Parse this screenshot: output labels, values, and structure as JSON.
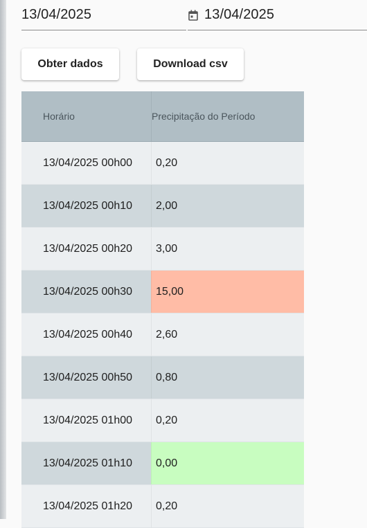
{
  "filters": {
    "start_date": "13/04/2025",
    "end_date": "13/04/2025",
    "calendar_icon": "calendar-icon"
  },
  "actions": {
    "fetch_label": "Obter dados",
    "download_label": "Download csv"
  },
  "table": {
    "headers": {
      "time": "Horário",
      "precipitation": "Precipitação do Período"
    },
    "rows": [
      {
        "time": "13/04/2025 00h00",
        "precipitation": "0,20",
        "highlight": "none"
      },
      {
        "time": "13/04/2025 00h10",
        "precipitation": "2,00",
        "highlight": "none"
      },
      {
        "time": "13/04/2025 00h20",
        "precipitation": "3,00",
        "highlight": "none"
      },
      {
        "time": "13/04/2025 00h30",
        "precipitation": "15,00",
        "highlight": "max"
      },
      {
        "time": "13/04/2025 00h40",
        "precipitation": "2,60",
        "highlight": "none"
      },
      {
        "time": "13/04/2025 00h50",
        "precipitation": "0,80",
        "highlight": "none"
      },
      {
        "time": "13/04/2025 01h00",
        "precipitation": "0,20",
        "highlight": "none"
      },
      {
        "time": "13/04/2025 01h10",
        "precipitation": "0,00",
        "highlight": "min"
      },
      {
        "time": "13/04/2025 01h20",
        "precipitation": "0,20",
        "highlight": "none"
      }
    ]
  },
  "colors": {
    "header_bg": "#b0bec5",
    "row_odd": "#eceff1",
    "row_even": "#cfd8dc",
    "highlight_max": "#ffbca6",
    "highlight_min": "#c8fdc0"
  }
}
